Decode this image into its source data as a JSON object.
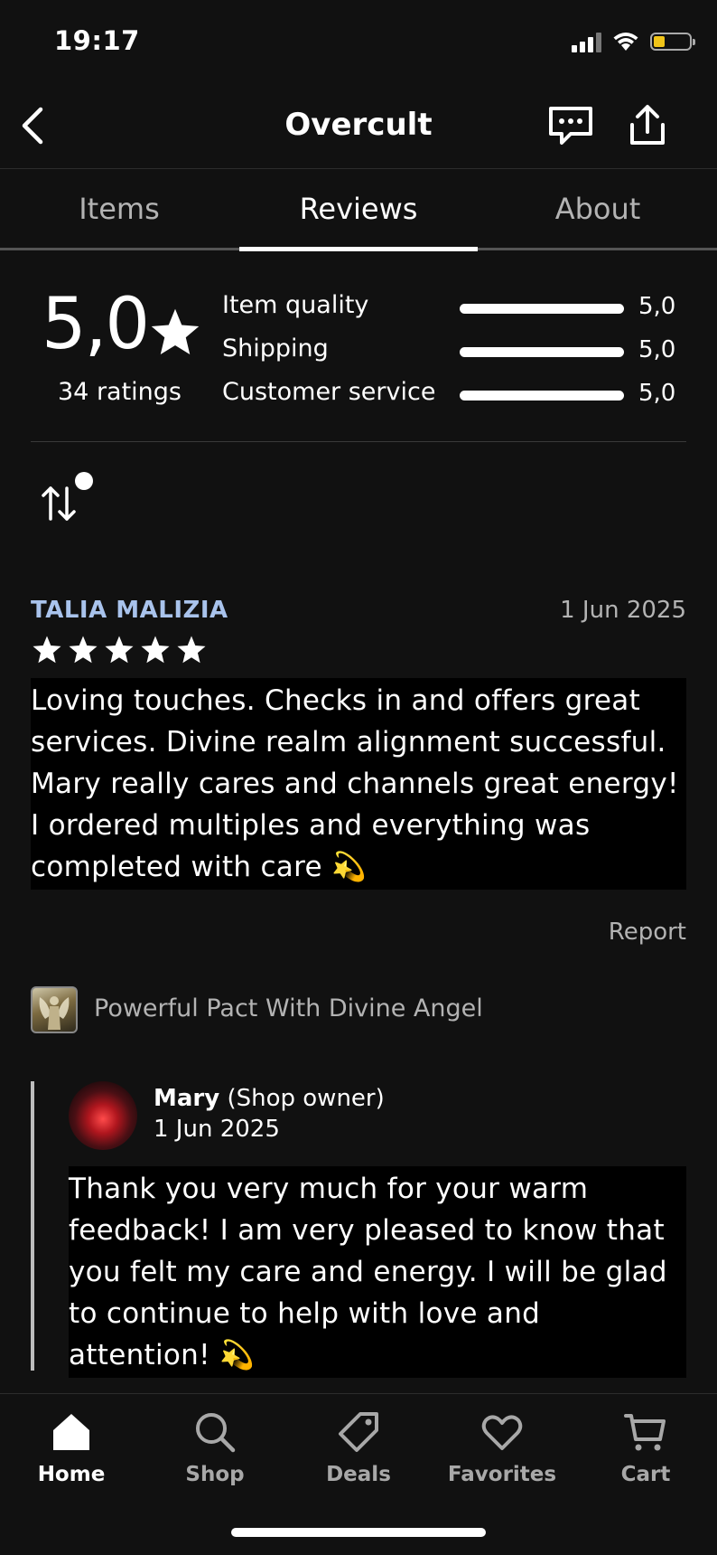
{
  "status_bar": {
    "time": "19:17"
  },
  "header": {
    "title": "Overcult"
  },
  "tabs": [
    {
      "label": "Items",
      "active": false
    },
    {
      "label": "Reviews",
      "active": true
    },
    {
      "label": "About",
      "active": false
    }
  ],
  "summary": {
    "overall": "5,0",
    "ratings_count": "34 ratings",
    "categories": [
      {
        "label": "Item quality",
        "value": "5,0",
        "fraction": 1.0
      },
      {
        "label": "Shipping",
        "value": "5,0",
        "fraction": 1.0
      },
      {
        "label": "Customer service",
        "value": "5,0",
        "fraction": 1.0
      }
    ]
  },
  "review": {
    "reviewer": "TALIA MALIZIA",
    "date": "1 Jun 2025",
    "stars": 5,
    "text": "Loving touches. Checks in and offers great services. Divine realm alignment successful. Mary really cares and channels great energy! I ordered multiples and everything was completed with care 💫",
    "report_label": "Report",
    "listing_title": "Powerful Pact With Divine Angel",
    "reply": {
      "owner_name": "Mary",
      "owner_role": "(Shop owner)",
      "date": "1 Jun 2025",
      "text": "Thank you very much for your warm feedback! I am very pleased to know that you felt my care and energy. I will be glad to continue to help with love and attention! 💫"
    }
  },
  "bottom_nav": [
    {
      "label": "Home",
      "icon": "home-icon",
      "active": true
    },
    {
      "label": "Shop",
      "icon": "search-icon",
      "active": false
    },
    {
      "label": "Deals",
      "icon": "tag-icon",
      "active": false
    },
    {
      "label": "Favorites",
      "icon": "heart-icon",
      "active": false
    },
    {
      "label": "Cart",
      "icon": "cart-icon",
      "active": false
    }
  ],
  "colors": {
    "background": "#111111",
    "reviewer_name": "#a9c3ec",
    "muted_text": "#b3b3b3",
    "battery_fill": "#f0c419"
  }
}
